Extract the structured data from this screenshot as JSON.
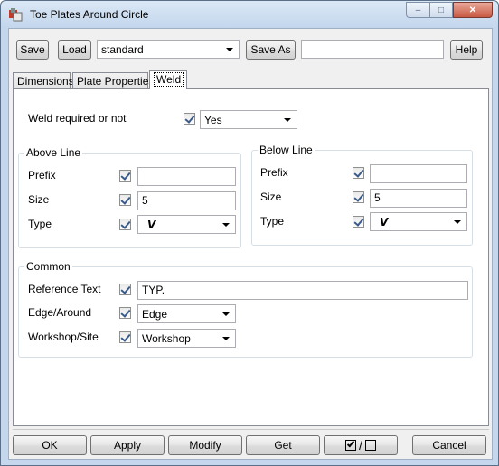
{
  "window": {
    "title": "Toe Plates Around Circle",
    "caption_min": "–",
    "caption_max": "□",
    "caption_close": "✕"
  },
  "toolbar": {
    "save_label": "Save",
    "load_label": "Load",
    "preset_value": "standard",
    "save_as_label": "Save As",
    "save_as_value": "",
    "help_label": "Help"
  },
  "tabs": [
    {
      "label": "Dimensions"
    },
    {
      "label": "Plate Properties"
    },
    {
      "label": "Weld",
      "active": true
    }
  ],
  "weld": {
    "required_label": "Weld required or not",
    "required_value": "Yes",
    "above": {
      "title": "Above Line",
      "prefix_label": "Prefix",
      "prefix_value": "",
      "size_label": "Size",
      "size_value": "5",
      "type_label": "Type",
      "type_value": "V"
    },
    "below": {
      "title": "Below Line",
      "prefix_label": "Prefix",
      "prefix_value": "",
      "size_label": "Size",
      "size_value": "5",
      "type_label": "Type",
      "type_value": "V"
    },
    "common": {
      "title": "Common",
      "reference_label": "Reference Text",
      "reference_value": "TYP.",
      "edge_label": "Edge/Around",
      "edge_value": "Edge",
      "workshop_label": "Workshop/Site",
      "workshop_value": "Workshop"
    }
  },
  "footer": {
    "ok_label": "OK",
    "apply_label": "Apply",
    "modify_label": "Modify",
    "get_label": "Get",
    "toggle_label": "/",
    "cancel_label": "Cancel"
  }
}
